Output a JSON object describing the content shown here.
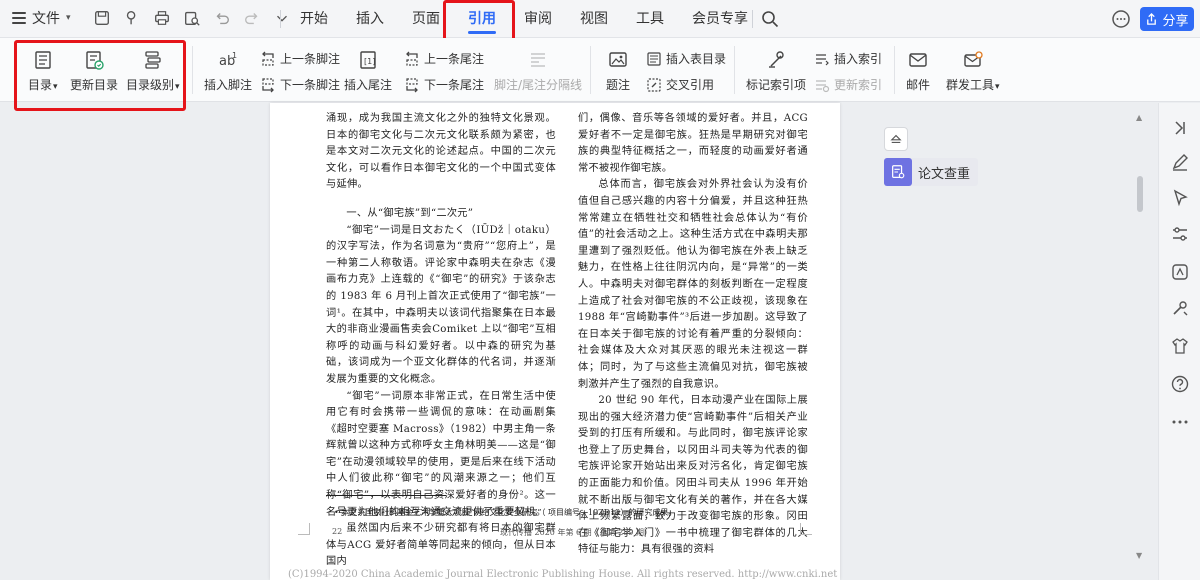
{
  "topbar": {
    "file_label": "文件",
    "tabs": [
      {
        "label": "开始"
      },
      {
        "label": "插入"
      },
      {
        "label": "页面"
      },
      {
        "label": "引用"
      },
      {
        "label": "审阅"
      },
      {
        "label": "视图"
      },
      {
        "label": "工具"
      },
      {
        "label": "会员专享"
      }
    ],
    "active_tab": "引用",
    "share_label": "分享"
  },
  "ribbon": {
    "toc": "目录",
    "update_toc": "更新目录",
    "toc_level": "目录级别",
    "insert_footnote": "插入脚注",
    "prev_footnote": "上一条脚注",
    "next_footnote": "下一条脚注",
    "insert_endnote": "插入尾注",
    "prev_endnote": "上一条尾注",
    "next_endnote": "下一条尾注",
    "separator_line": "脚注/尾注分隔线",
    "caption": "题注",
    "insert_table_of_figures": "插入表目录",
    "cross_reference": "交叉引用",
    "mark_index_entry": "标记索引项",
    "insert_index": "插入索引",
    "update_index": "更新索引",
    "mail": "邮件",
    "mass_mail_tools": "群发工具"
  },
  "side_panel": {
    "paper_check": "论文查重"
  },
  "document": {
    "left_column": [
      "涌现，成为我国主流文化之外的独特文化景观。日本的御宅文化与二次元文化联系颇为紧密，也是本文对二次元文化的论述起点。中国的二次元文化，可以看作日本御宅文化的一个中国式变体与延伸。",
      "一、从“御宅族”到“二次元”",
      "“御宅”一词是日文おたく（IŪDž｜otaku）的汉字写法，作为名词意为“贵府”“您府上”，是一种第二人称敬语。评论家中森明夫在杂志《漫画布力克》上连载的《“御宅”的研究》于该杂志的 1983 年 6 月刊上首次正式使用了“御宅族”一词¹。在其中，中森明夫以该词代指聚集在日本最大的非商业漫画售卖会Comiket 上以“御宅”互相称呼的动画与科幻爱好者。以中森的研究为基础，该词成为一个亚文化群体的代名词，并逐渐发展为重要的文化概念。",
      "“御宅”一词原本非常正式，在日常生活中使用它有时会携带一些调侃的意味：在动画剧集《超时空要塞 Macross》（1982）中男主角一条辉就曾以这种方式称呼女主角林明美——这是“御宅”在动漫领域较早的使用，更是后来在线下活动中人们彼此称“御宅”的风潮来源之一；他们互称“御宅”，以表明自己资深爱好者的身份²。这一名号更为他们的相互沟通交流提供了重要契机。",
      "虽然国内后来不少研究都有将日本的御宅群体与ACG 爱好者简单等同起来的倾向，但从日本国内"
    ],
    "right_column": [
      "们，偶像、音乐等各领域的爱好者。并且，ACG 爱好者不一定是御宅族。狂热是早期研究对御宅族的典型特征概括之一，而轻度的动画爱好者通常不被视作御宅族。",
      "总体而言，御宅族会对外界社会认为没有价值但自己感兴趣的内容十分偏爱，并且这种狂热常常建立在牺牲社交和牺牲社会总体认为“有价值”的社会活动之上。这种生活方式在中森明夫那里遭到了强烈贬低。他认为御宅族在外表上缺乏魅力，在性格上往往阴沉内向，是“异常”的一类人。中森明夫对御宅群体的刻板判断在一定程度上造成了社会对御宅族的不公正歧视，该现象在 1988 年“宫崎勤事件”³后进一步加剧。这导致了在日本关于御宅族的讨论有着严重的分裂倾向：社会媒体及大众对其厌恶的眼光未注视这一群体；同时，为了与这些主流偏见对抗，御宅族被刺激并产生了强烈的自我意识。",
      "20 世纪 90 年代，日本动漫产业在国际上展现出的强大经济潜力使“宫崎勤事件”后相关产业受到的打压有所缓和。与此同时，御宅族评论家也登上了历史舞台，以冈田斗司夫等为代表的御宅族评论家开始站出来反对污名化，肯定御宅族的正面能力和价值。冈田斗司夫从 1996 年开始就不断出版与御宅文化有关的著作，并在各大媒体上频繁露面，致力于改变御宅族的形象。冈田在《御宅学入门》一书中梳理了御宅群体的几大特征与能力：具有很强的资料"
    ],
    "footnote": "本文系国家社科基金艺术学重大项目“网络文化安全研究”（ 项目编号：19ZD12）的研究成果。",
    "page_number": "22",
    "page_footer": "现代传播 2020 年第 6 期（总第 289 期）",
    "watermark": "(C)1994-2020 China Academic Journal Electronic Publishing House. All rights reserved.    http://www.cnki.net"
  },
  "colors": {
    "accent": "#2f6bf6",
    "highlight_red": "#e5141a",
    "check_icon_bg": "#6e72e2"
  }
}
